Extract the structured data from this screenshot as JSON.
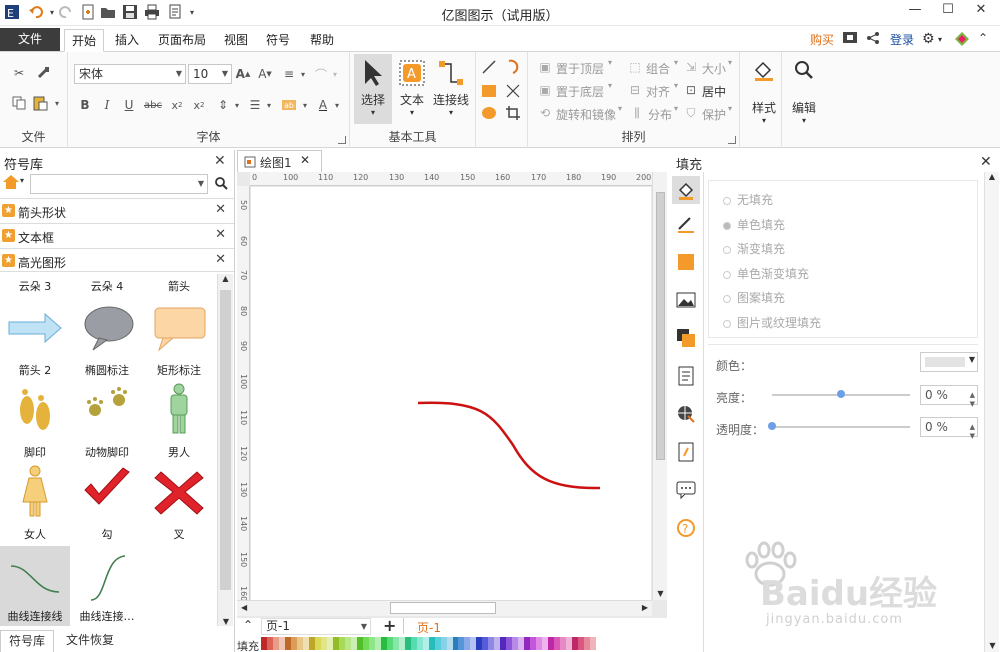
{
  "app": {
    "title": "亿图图示（试用版）",
    "accent": "#3c3c3c",
    "quick_access_icons": [
      "app-logo-icon",
      "undo-icon",
      "redo-icon",
      "new-icon",
      "open-icon",
      "save-icon",
      "print-icon",
      "export-icon"
    ]
  },
  "menu": {
    "file": "文件",
    "tabs": [
      "开始",
      "插入",
      "页面布局",
      "视图",
      "符号",
      "帮助"
    ],
    "active_tab": "开始",
    "buy": "购买",
    "login": "登录"
  },
  "ribbon": {
    "font_group": {
      "label": "字体",
      "font_name": "宋体",
      "font_size": "10"
    },
    "file_group": {
      "label": "文件"
    },
    "basic_tools": {
      "label": "基本工具",
      "select": "选择",
      "text": "文本",
      "connector": "连接线"
    },
    "arrange": {
      "label": "排列",
      "bring_front": "置于顶层",
      "send_back": "置于底层",
      "rotate_mirror": "旋转和镜像",
      "group": "组合",
      "align": "对齐",
      "distribute": "分布",
      "size": "大小",
      "center": "居中",
      "protect": "保护"
    },
    "style": "样式",
    "edit": "编辑"
  },
  "library": {
    "title": "符号库",
    "search_placeholder": "",
    "categories": [
      "箭头形状",
      "文本框",
      "高光图形"
    ],
    "shapes": [
      {
        "label": "云朵 3"
      },
      {
        "label": "云朵 4"
      },
      {
        "label": "箭头"
      },
      {
        "label": "箭头 2"
      },
      {
        "label": "椭圆标注"
      },
      {
        "label": "矩形标注"
      },
      {
        "label": "脚印"
      },
      {
        "label": "动物脚印"
      },
      {
        "label": "男人"
      },
      {
        "label": "女人"
      },
      {
        "label": "勾"
      },
      {
        "label": "叉"
      },
      {
        "label": "曲线连接线"
      },
      {
        "label": "曲线连接…"
      }
    ],
    "bottom_tabs": [
      "符号库",
      "文件恢复"
    ]
  },
  "document": {
    "tab": "绘图1",
    "ruler_h": [
      "0",
      "100",
      "110",
      "120",
      "130",
      "140",
      "150",
      "160",
      "170",
      "180",
      "190",
      "200"
    ],
    "ruler_v": [
      "50",
      "60",
      "70",
      "80",
      "90",
      "100",
      "110",
      "120",
      "130",
      "140",
      "150",
      "160"
    ],
    "curve_color": "#cc1111",
    "page_selector": "页-1",
    "page_tab": "页-1",
    "fill_label": "填充"
  },
  "fill_panel": {
    "title": "填充",
    "options": [
      "无填充",
      "单色填充",
      "渐变填充",
      "单色渐变填充",
      "图案填充",
      "图片或纹理填充"
    ],
    "selected": "单色填充",
    "color_label": "颜色：",
    "brightness_label": "亮度：",
    "brightness_value": "0 %",
    "transparency_label": "透明度：",
    "transparency_value": "0 %",
    "brightness_level": 0.5,
    "transparency_level": 0
  },
  "watermark": {
    "brand": "Baidu经验",
    "url": "jingyan.baidu.com"
  }
}
